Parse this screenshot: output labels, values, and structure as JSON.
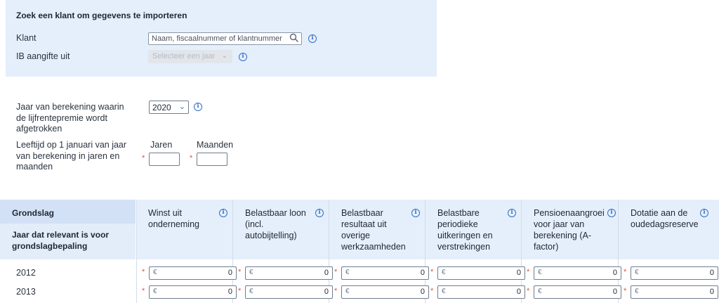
{
  "search": {
    "title": "Zoek een klant om gegevens te importeren",
    "client_label": "Klant",
    "client_placeholder": "Naam, fiscaalnummer of klantnummer",
    "ib_label": "IB aangifte uit",
    "ib_select_value": "Selecteer een jaar"
  },
  "form": {
    "year_label": "Jaar van berekening waarin de lijfrentepremie wordt afgetrokken",
    "year_value": "2020",
    "age_label": "Leeftijd op 1 januari van jaar van berekening in jaren en maanden",
    "years_label": "Jaren",
    "months_label": "Maanden",
    "required_mark": "*"
  },
  "table": {
    "basis_label": "Grondslag",
    "year_relevant_label": "Jaar dat relevant is voor grondslagbepaling",
    "currency_symbol": "€",
    "columns": [
      {
        "label": "Winst uit onderneming"
      },
      {
        "label": "Belastbaar loon (incl. autobijtelling)"
      },
      {
        "label": "Belastbaar resultaat uit overige werkzaamheden"
      },
      {
        "label": "Belastbare periodieke uitkeringen en verstrekingen"
      },
      {
        "label": "Pensioenaangroei voor jaar van berekening (A-factor)"
      },
      {
        "label": "Dotatie aan de oudedagsreserve"
      }
    ],
    "rows": [
      {
        "year": "2012",
        "values": [
          "0",
          "0",
          "0",
          "0",
          "0",
          "0"
        ]
      },
      {
        "year": "2013",
        "values": [
          "0",
          "0",
          "0",
          "0",
          "0",
          "0"
        ]
      }
    ]
  },
  "icons": {
    "info": "info-icon",
    "search": "search-icon",
    "chevron": "chevron-down-icon"
  },
  "colors": {
    "accent": "#2f6fc7",
    "required": "#e0523c",
    "panel_bg": "#e5effb"
  }
}
